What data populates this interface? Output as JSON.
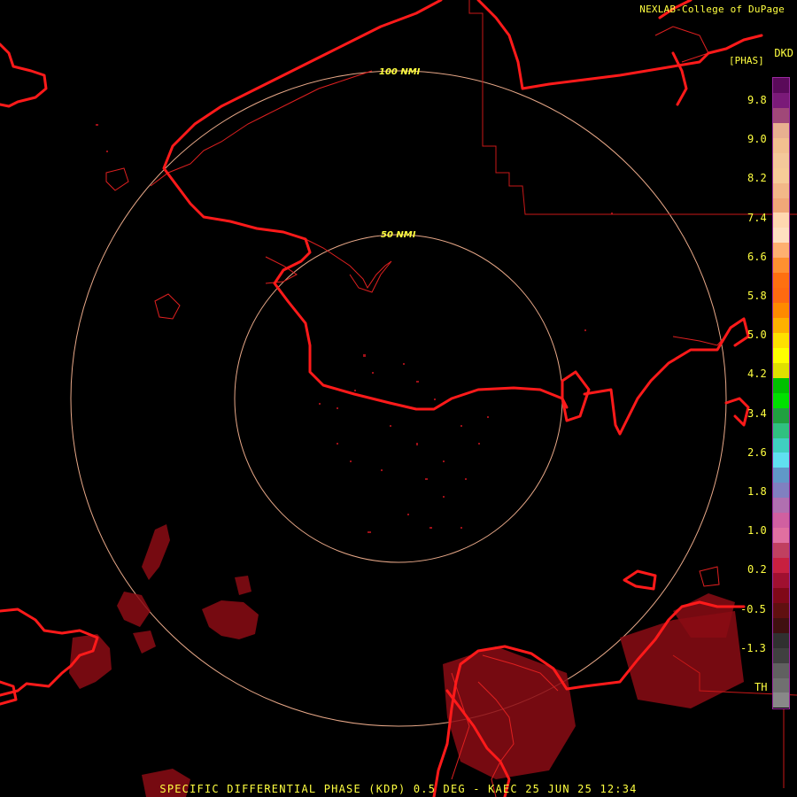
{
  "credit": "NEXLAB-College of DuPage",
  "product_code": "DKD",
  "units": "[PHAS]",
  "range_rings": [
    "100 NMI",
    "50 NMI"
  ],
  "legend": {
    "ticks": [
      "9.8",
      "9.0",
      "8.2",
      "7.4",
      "6.6",
      "5.8",
      "5.0",
      "4.2",
      "3.4",
      "2.6",
      "1.8",
      "1.0",
      "0.2",
      "-0.5",
      "-1.3",
      "TH"
    ],
    "colors": [
      "#5a0a5a",
      "#7a1a78",
      "#a04878",
      "#e8b090",
      "#f2c090",
      "#f4c89a",
      "#f6cc98",
      "#f2b888",
      "#f0a878",
      "#ffd8b0",
      "#ffe0c0",
      "#ffb070",
      "#ff9030",
      "#ff7010",
      "#ff6a10",
      "#ff8a00",
      "#ffb000",
      "#ffe000",
      "#ffff00",
      "#e0e000",
      "#00c000",
      "#00e000",
      "#20a040",
      "#30c080",
      "#40d0c0",
      "#60e0f0",
      "#6098c8",
      "#8080c0",
      "#b070b0",
      "#d060a0",
      "#e070a0",
      "#c04060",
      "#c82040",
      "#a01030",
      "#800818",
      "#601010",
      "#401010",
      "#303030",
      "#404040",
      "#606060",
      "#707070",
      "#888888"
    ]
  },
  "title": "SPECIFIC DIFFERENTIAL PHASE (KDP) 0.5 DEG - KAEC 25 JUN 25 12:34"
}
